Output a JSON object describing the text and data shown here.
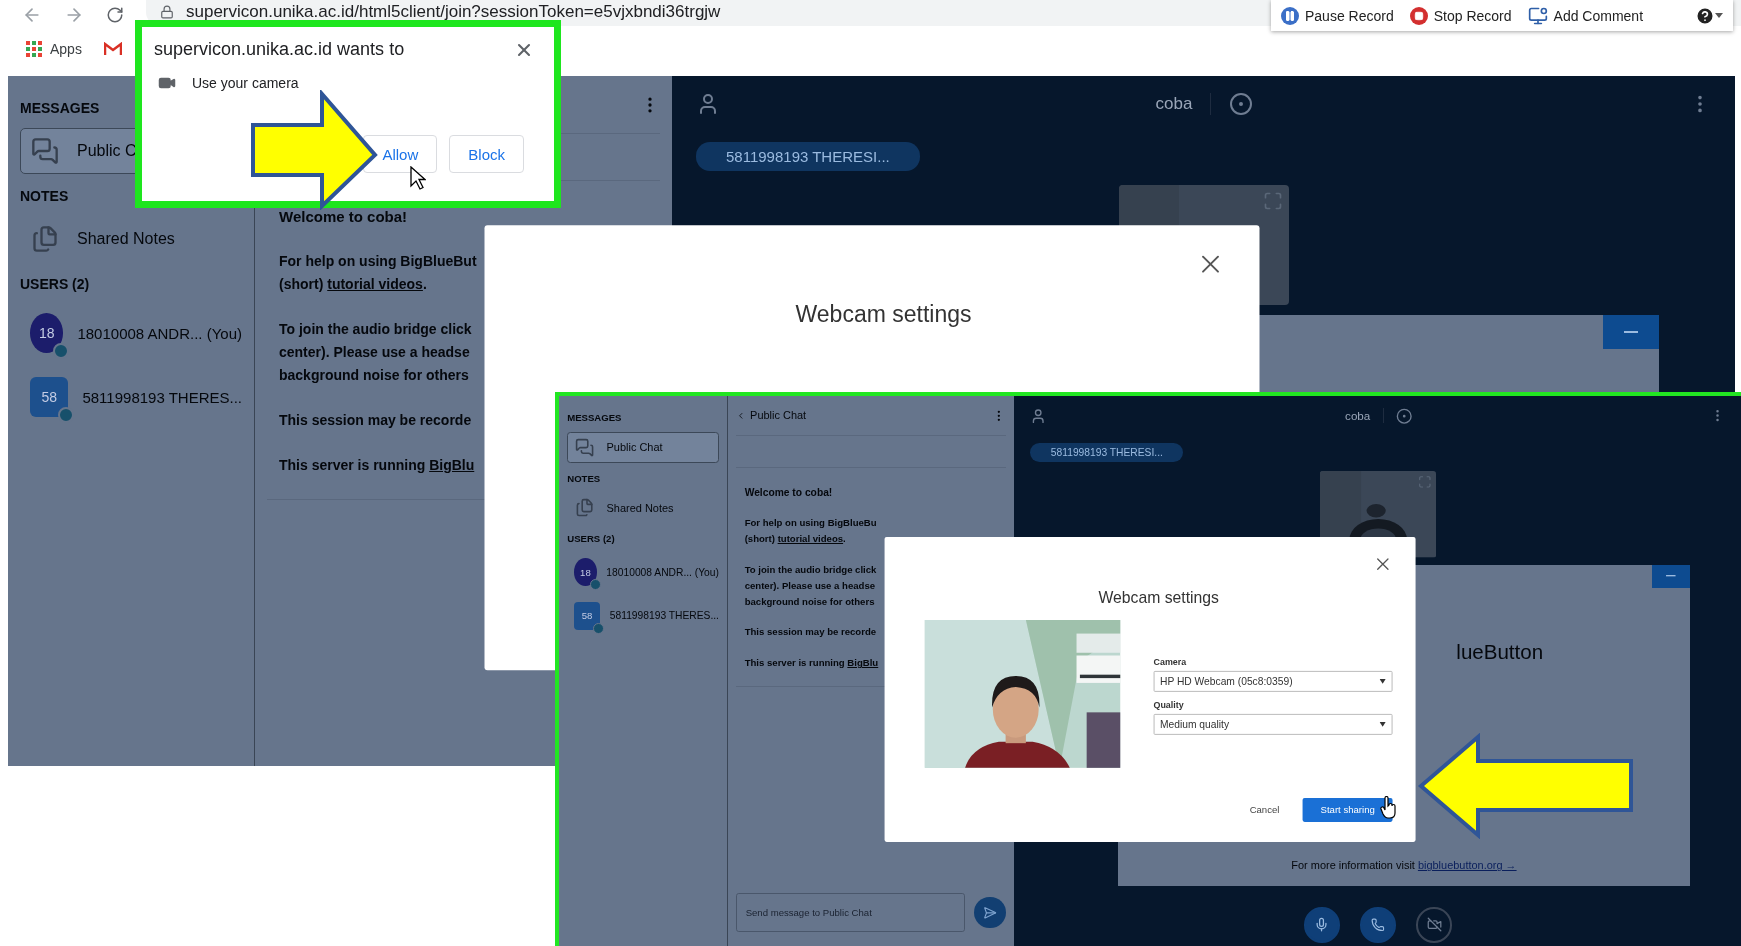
{
  "browser": {
    "address": "supervicon.unika.ac.id/html5client/join?sessionToken=e5vjxbndi36trgjw",
    "bookmarks": [
      {
        "label": "Apps"
      }
    ]
  },
  "recorder": {
    "buttons": [
      {
        "label": "Pause Record",
        "kind": "pause"
      },
      {
        "label": "Stop Record",
        "kind": "stop"
      },
      {
        "label": "Add Comment",
        "kind": "comment"
      }
    ]
  },
  "permission_popup": {
    "title": "supervicon.unika.ac.id wants to",
    "request": "Use your camera",
    "buttons": [
      "Allow",
      "Block"
    ]
  },
  "screens": [
    {
      "sidebar": {
        "sections": [
          {
            "heading": "MESSAGES",
            "items": [
              {
                "label": "Public C",
                "kind": "chat",
                "selected": true
              }
            ]
          },
          {
            "heading": "NOTES",
            "items": [
              {
                "label": "Shared Notes",
                "kind": "notes",
                "selected": false
              }
            ]
          }
        ],
        "users_heading": "USERS (2)",
        "users": [
          {
            "avatar": "18",
            "name": "18010008 ANDR... (You)",
            "kind": "viewer",
            "color": "#1c1d6b"
          },
          {
            "avatar": "58",
            "name": "5811998193 THERES...",
            "kind": "moderator",
            "color": "#1d508d"
          }
        ]
      },
      "chat": {
        "messages": [
          {
            "kind": "title",
            "lines": [
              {
                "text": "Welcome to coba!"
              }
            ]
          },
          {
            "kind": "text",
            "lines": [
              {
                "text": "For help on using BigBlueBut"
              },
              {
                "text": "(short) ",
                "link": "tutorial videos",
                "after": "."
              }
            ]
          },
          {
            "kind": "text",
            "lines": [
              {
                "text": "To join the audio bridge click"
              },
              {
                "text": "center). Please use a headse"
              },
              {
                "text": "background noise for others"
              }
            ]
          },
          {
            "kind": "text",
            "lines": [
              {
                "text": "This session may be recorde"
              }
            ]
          },
          {
            "kind": "text",
            "lines": [
              {
                "text": "This server is running ",
                "link": "BigBlu"
              }
            ]
          }
        ]
      },
      "main": {
        "title": "coba",
        "presenter_tag": "5811998193 THERESI..."
      },
      "modal": {
        "title": "Webcam settings"
      }
    },
    {
      "sidebar": {
        "sections": [
          {
            "heading": "MESSAGES",
            "items": [
              {
                "label": "Public Chat",
                "kind": "chat",
                "selected": true
              }
            ]
          },
          {
            "heading": "NOTES",
            "items": [
              {
                "label": "Shared Notes",
                "kind": "notes",
                "selected": false
              }
            ]
          }
        ],
        "users_heading": "USERS (2)",
        "users": [
          {
            "avatar": "18",
            "name": "18010008 ANDR... (You)",
            "kind": "viewer",
            "color": "#1c1d6b"
          },
          {
            "avatar": "58",
            "name": "5811998193 THERES...",
            "kind": "moderator",
            "color": "#1d508d"
          }
        ]
      },
      "chat": {
        "header": "Public Chat",
        "messages": [
          {
            "kind": "title",
            "lines": [
              {
                "text": "Welcome to coba!"
              }
            ]
          },
          {
            "kind": "text",
            "lines": [
              {
                "text": "For help on using BigBlueBu"
              },
              {
                "text": "(short) ",
                "link": "tutorial videos",
                "after": "."
              }
            ]
          },
          {
            "kind": "text",
            "lines": [
              {
                "text": "To join the audio bridge click"
              },
              {
                "text": "center). Please use a headse"
              },
              {
                "text": "background noise for others"
              }
            ]
          },
          {
            "kind": "text",
            "lines": [
              {
                "text": "This session may be recorde"
              }
            ]
          },
          {
            "kind": "text",
            "lines": [
              {
                "text": "This server is running ",
                "link": "BigBlu"
              }
            ]
          }
        ],
        "input_placeholder": "Send message to Public Chat"
      },
      "main": {
        "title": "coba",
        "presenter_tag": "5811998193 THERESI...",
        "presentation": {
          "heading": "lueButton",
          "footer": "For more information visit ",
          "footer_link": "bigbluebutton.org →"
        },
        "actions": [
          {
            "kind": "microphone",
            "active": true
          },
          {
            "kind": "phone",
            "active": true
          },
          {
            "kind": "camera",
            "active": false
          }
        ]
      },
      "modal": {
        "title": "Webcam settings",
        "fields": [
          {
            "label": "Camera",
            "value": "HP HD Webcam (05c8:0359)"
          },
          {
            "label": "Quality",
            "value": "Medium quality"
          }
        ],
        "buttons": [
          {
            "label": "Cancel",
            "kind": "secondary"
          },
          {
            "label": "Start sharing",
            "kind": "primary"
          }
        ]
      }
    }
  ]
}
